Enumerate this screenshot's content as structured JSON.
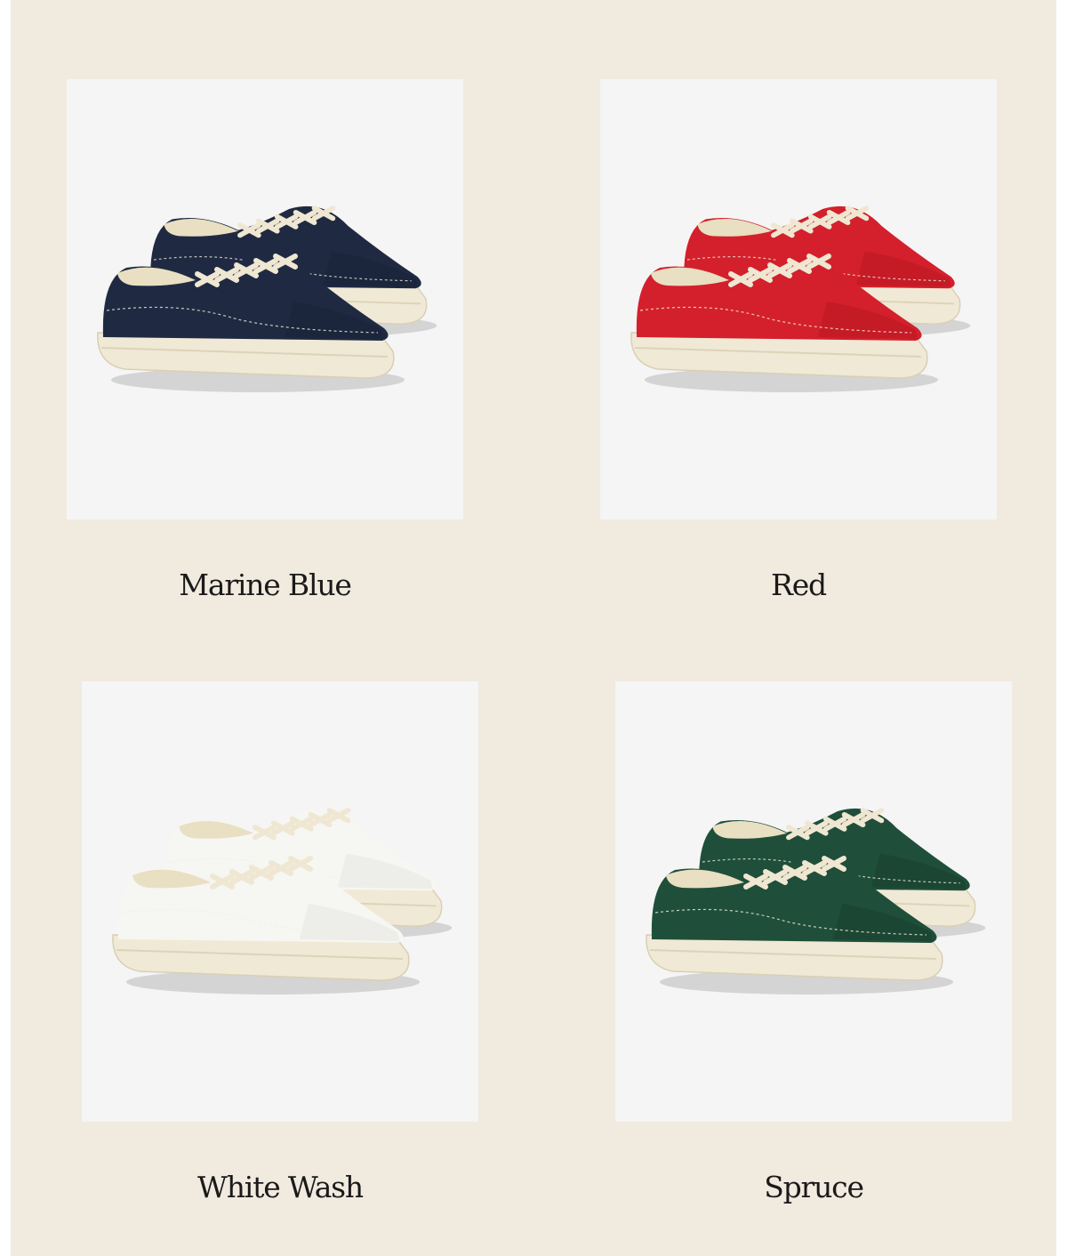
{
  "products": [
    {
      "name": "Marine Blue",
      "upper": "#1f2a42",
      "upper_dark": "#141c30",
      "icon": "sneaker-marine-blue"
    },
    {
      "name": "Red",
      "upper": "#d4202c",
      "upper_dark": "#a8141f",
      "icon": "sneaker-red"
    },
    {
      "name": "White Wash",
      "upper": "#f6f6f3",
      "upper_dark": "#dcdcd6",
      "icon": "sneaker-white-wash"
    },
    {
      "name": "Spruce",
      "upper": "#1f4f3a",
      "upper_dark": "#143628",
      "icon": "sneaker-spruce"
    }
  ],
  "colors": {
    "background": "#f1eadf",
    "card": "#f5f5f5",
    "sole": "#f0e9d6",
    "lining": "#e9dfc2",
    "laces": "#efe7d2"
  }
}
